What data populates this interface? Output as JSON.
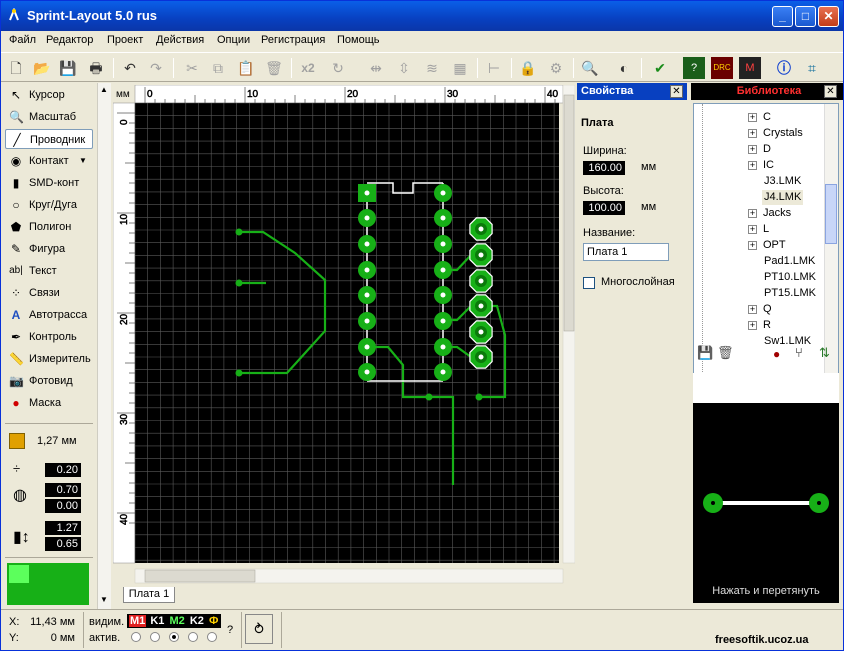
{
  "window": {
    "title": "Sprint-Layout 5.0 rus",
    "min": "_",
    "max": "□",
    "close": "✕"
  },
  "menu": [
    "Файл",
    "Редактор",
    "Проект",
    "Действия",
    "Опции",
    "Регистрация",
    "Помощь"
  ],
  "toolbar": {
    "dup_label": "x2"
  },
  "tools": [
    {
      "label": "Курсор",
      "icon": "cursor-icon"
    },
    {
      "label": "Масштаб",
      "icon": "zoom-icon"
    },
    {
      "label": "Проводник",
      "icon": "track-icon",
      "active": true
    },
    {
      "label": "Контакт",
      "icon": "pad-icon"
    },
    {
      "label": "SMD-конт",
      "icon": "smd-pad-icon"
    },
    {
      "label": "Круг/Дуга",
      "icon": "circle-icon"
    },
    {
      "label": "Полигон",
      "icon": "polygon-icon"
    },
    {
      "label": "Фигура",
      "icon": "shape-icon"
    },
    {
      "label": "Текст",
      "icon": "text-icon"
    },
    {
      "label": "Связи",
      "icon": "connections-icon"
    },
    {
      "label": "Автотрасса",
      "icon": "autoroute-icon"
    },
    {
      "label": "Контроль",
      "icon": "check-icon"
    },
    {
      "label": "Измеритель",
      "icon": "ruler-icon"
    },
    {
      "label": "Фотовид",
      "icon": "photoview-icon"
    },
    {
      "label": "Маска",
      "icon": "mask-icon"
    }
  ],
  "grid": {
    "label": "1,27 мм"
  },
  "params": {
    "track_width": "0.20",
    "pad_outer": "0.70",
    "pad_inner": "0.00",
    "smd_w": "1.27",
    "smd_h": "0.65"
  },
  "ruler": {
    "unit": "мм",
    "x_ticks": [
      "0",
      "10",
      "20",
      "30",
      "40"
    ],
    "y_ticks": [
      "0",
      "10",
      "20",
      "30",
      "40"
    ]
  },
  "tab": {
    "label": "Плата 1"
  },
  "properties": {
    "title": "Свойства",
    "section": "Плата",
    "width_label": "Ширина:",
    "width_value": "160.00",
    "width_unit": "мм",
    "height_label": "Высота:",
    "height_value": "100.00",
    "height_unit": "мм",
    "name_label": "Название:",
    "name_value": "Плата 1",
    "multilayer_label": "Многослойная"
  },
  "library": {
    "title": "Библиотека",
    "items": [
      "C",
      "Crystals",
      "D",
      "IC",
      "J3.LMK",
      "J4.LMK",
      "Jacks",
      "L",
      "OPT",
      "Pad1.LMK",
      "PT10.LMK",
      "PT15.LMK",
      "Q",
      "R",
      "Sw1.LMK"
    ],
    "drag_hint": "Нажать и перетянуть"
  },
  "status": {
    "x_label": "X:",
    "x_value": "11,43 мм",
    "y_label": "Y:",
    "y_value": "0 мм",
    "visible_label": "видим.",
    "active_label": "актив.",
    "layers": [
      "M1",
      "K1",
      "M2",
      "K2",
      "Ф"
    ],
    "help": "?",
    "watermark": "freesoftik.ucoz.ua"
  },
  "colors": {
    "copper": "#17b017",
    "canvas": "#000000",
    "grid": "#5a5a5a",
    "title": "#0840c0",
    "lib_head": "#d40000"
  }
}
